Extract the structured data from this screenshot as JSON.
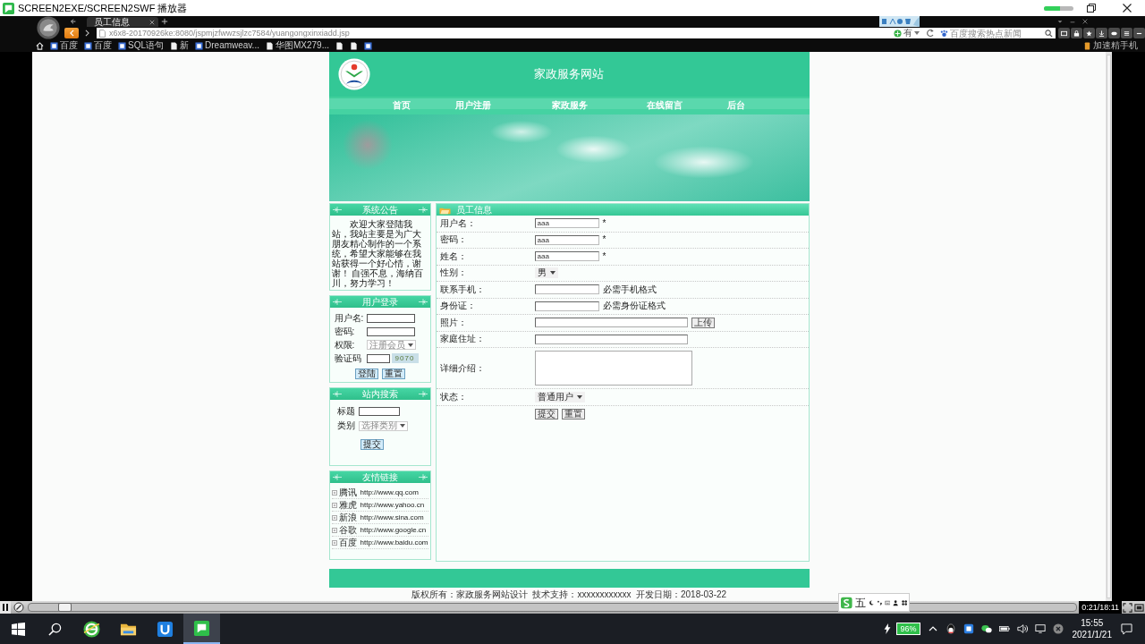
{
  "window": {
    "title": "SCREEN2EXE/SCREEN2SWF 播放器",
    "meter": {
      "level": 0.55
    }
  },
  "browser": {
    "tabs": [
      {
        "title": "员工信息",
        "selected": true
      }
    ],
    "address": "x6x8-20170926ke:8080/jspmjzfwwzsjlzc7584/yuangongxinxiadd.jsp",
    "search_engine": "有",
    "search": {
      "placeholder": "百度搜索热点新闻"
    },
    "bookmarks": [
      {
        "label": "百度",
        "kind": "site"
      },
      {
        "label": "百度",
        "kind": "site"
      },
      {
        "label": "SQL语句",
        "kind": "site"
      },
      {
        "label": "新",
        "kind": "doc"
      },
      {
        "label": "Dreamweav...",
        "kind": "site"
      },
      {
        "label": "华图MX279...",
        "kind": "doc"
      },
      {
        "kind": "doc"
      },
      {
        "kind": "doc"
      },
      {
        "kind": "site"
      }
    ],
    "extension": "加速精手机"
  },
  "site": {
    "title": "家政服务网站",
    "nav": [
      {
        "label": "首页"
      },
      {
        "label": "用户注册"
      },
      {
        "label": "家政服务"
      },
      {
        "label": "在线留言"
      },
      {
        "label": "后台"
      }
    ]
  },
  "notice": {
    "title": "系统公告",
    "text": "欢迎大家登陆我站，我站主要是为广大朋友精心制作的一个系统，希望大家能够在我站获得一个好心情，谢谢！ 自强不息，海纳百川，努力学习！"
  },
  "login": {
    "title": "用户登录",
    "fields": [
      {
        "label": "用户名:",
        "kind": "input"
      },
      {
        "label": "密码:",
        "kind": "input"
      },
      {
        "label": "权限:",
        "kind": "select",
        "value": "注册会员"
      },
      {
        "label": "验证码",
        "kind": "captcha",
        "captcha": "9070"
      }
    ],
    "buttons": [
      "登陆",
      "重置"
    ]
  },
  "site_search": {
    "title": "站内搜索",
    "fields": [
      {
        "label": "标题",
        "kind": "input"
      },
      {
        "label": "类别",
        "kind": "select",
        "value": "选择类别"
      }
    ],
    "buttons": [
      "提交"
    ]
  },
  "links": {
    "title": "友情链接",
    "items": [
      {
        "name": "腾讯",
        "url": "http://www.qq.com"
      },
      {
        "name": "雅虎",
        "url": "http://www.yahoo.cn"
      },
      {
        "name": "新浪",
        "url": "http://www.sina.com"
      },
      {
        "name": "谷歌",
        "url": "http://www.google.cn"
      },
      {
        "name": "百度",
        "url": "http://www.baidu.com"
      }
    ]
  },
  "form": {
    "title": "员工信息",
    "rows": [
      {
        "label": "用户名：",
        "kind": "text",
        "value": "aaa",
        "note": "*"
      },
      {
        "label": "密码：",
        "kind": "text",
        "value": "aaa",
        "note": "*"
      },
      {
        "label": "姓名：",
        "kind": "text",
        "value": "aaa",
        "note": "*"
      },
      {
        "label": "性别：",
        "kind": "select",
        "value": "男"
      },
      {
        "label": "联系手机：",
        "kind": "text",
        "note": "必需手机格式"
      },
      {
        "label": "身份证：",
        "kind": "text",
        "note": "必需身份证格式"
      },
      {
        "label": "照片：",
        "kind": "file",
        "button": "上传"
      },
      {
        "label": "家庭住址：",
        "kind": "wide"
      },
      {
        "label": "详细介绍：",
        "kind": "textarea"
      },
      {
        "label": "状态：",
        "kind": "select",
        "value": "普通用户"
      }
    ],
    "buttons": [
      "提交",
      "重置"
    ]
  },
  "footer": {
    "text": "版权所有：家政服务网站设计  技术支持：xxxxxxxxxxxx  开发日期：2018-03-22"
  },
  "player": {
    "progress": {
      "level": 0.02
    },
    "time": "0:21/18:11"
  },
  "ime": {
    "mode": "五"
  },
  "taskbar": {
    "apps": [
      {
        "kind": "browser",
        "selected": false
      },
      {
        "kind": "files",
        "selected": false
      },
      {
        "kind": "store",
        "selected": false
      },
      {
        "kind": "player",
        "selected": true
      }
    ],
    "battery": "96%",
    "time": "15:55",
    "date": "2021/1/21"
  }
}
